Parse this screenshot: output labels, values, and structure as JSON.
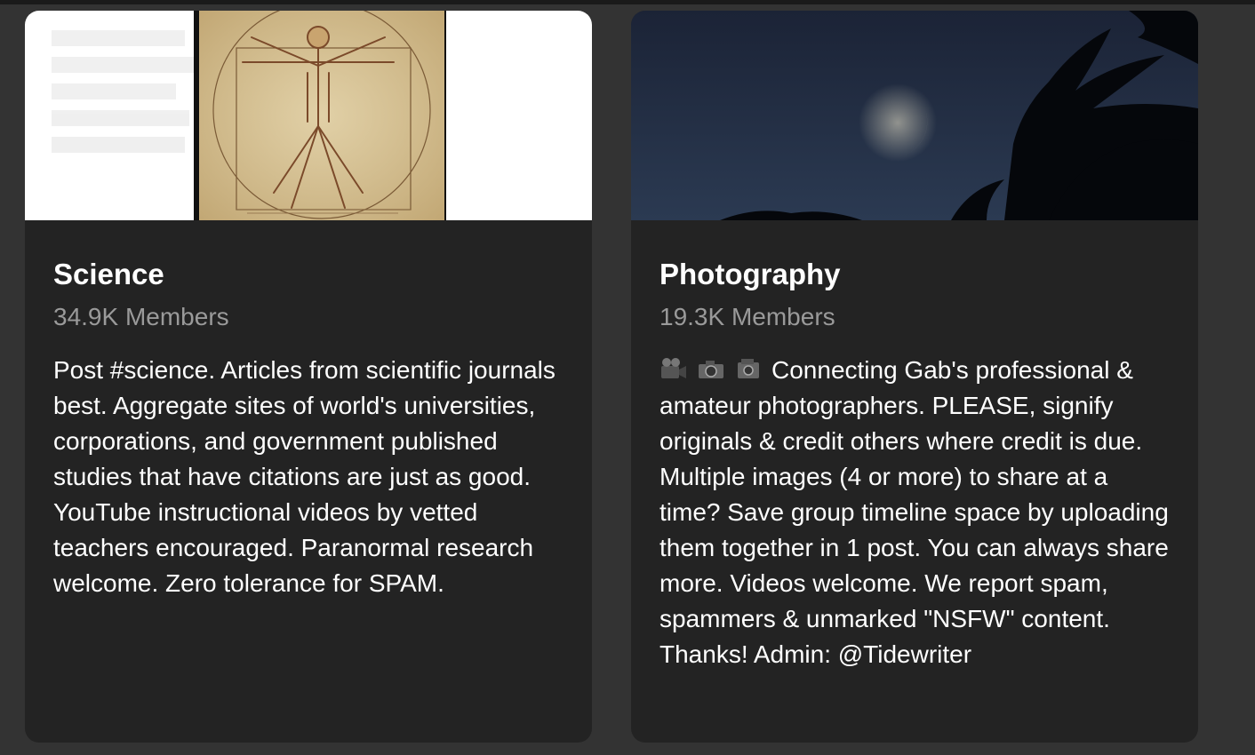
{
  "groups": [
    {
      "title": "Science",
      "members": "34.9K Members",
      "description": "Post #science. Articles from scientific journals best. Aggregate sites of world's universities, corporations, and government published studies that have citations are just as good. YouTube instructional videos by vetted teachers encouraged. Paranormal research welcome. Zero tolerance for SPAM.",
      "banner_icon": "vitruvian-man-drawing"
    },
    {
      "title": "Photography",
      "members": "19.3K Members",
      "description_icons": [
        "movie-camera-icon",
        "camera-icon",
        "video-camera-icon"
      ],
      "description": "Connecting Gab's professional & amateur photographers. PLEASE, signify originals & credit others where credit is due. Multiple images (4 or more) to share at a time? Save group timeline space by uploading them together in 1 post. You can always share more. Videos welcome. We report spam, spammers & unmarked \"NSFW\" content. Thanks! Admin: @Tidewriter",
      "banner_icon": "crescent-moon-night-sky"
    }
  ],
  "colors": {
    "page_background": "#333333",
    "card_background": "#232323",
    "title": "#ffffff",
    "members": "#9a9a9a",
    "description": "#ffffff"
  }
}
